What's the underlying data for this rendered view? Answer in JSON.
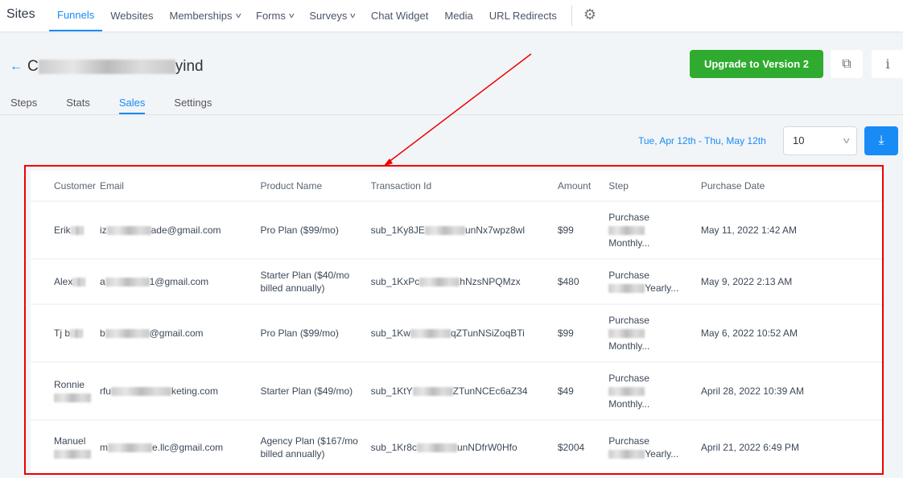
{
  "nav": {
    "brand": "Sites",
    "items": [
      {
        "label": "Funnels",
        "active": true,
        "dropdown": false
      },
      {
        "label": "Websites",
        "dropdown": false
      },
      {
        "label": "Memberships",
        "dropdown": true
      },
      {
        "label": "Forms",
        "dropdown": true
      },
      {
        "label": "Surveys",
        "dropdown": true
      },
      {
        "label": "Chat Widget",
        "dropdown": false
      },
      {
        "label": "Media",
        "dropdown": false
      },
      {
        "label": "URL Redirects",
        "dropdown": false
      }
    ],
    "settings_icon": "gear-icon"
  },
  "page": {
    "title_prefix": "C",
    "title_suffix": "yind",
    "upgrade_label": "Upgrade to Version 2",
    "info_label": "i",
    "tabs": [
      "Steps",
      "Stats",
      "Sales",
      "Settings"
    ],
    "active_tab": "Sales"
  },
  "filters": {
    "date_range": "Tue, Apr 12th - Thu, May 12th",
    "page_size": "10"
  },
  "table": {
    "columns": [
      "Customer",
      "Email",
      "Product Name",
      "Transaction Id",
      "Amount",
      "Step",
      "Purchase Date"
    ],
    "rows": [
      {
        "customer": [
          "Erik",
          ""
        ],
        "email": [
          "iz",
          "ade@gmail.com"
        ],
        "product": "Pro Plan ($99/mo)",
        "txn": [
          "sub_1Ky8JE",
          "unNx7wpz8wl"
        ],
        "amount": "$99",
        "step": [
          "Purchase",
          "",
          "Monthly..."
        ],
        "date": "May 11, 2022 1:42 AM"
      },
      {
        "customer": [
          "Alex",
          ""
        ],
        "email": [
          "a",
          "1@gmail.com"
        ],
        "product": "Starter Plan ($40/mo billed annually)",
        "txn": [
          "sub_1KxPc",
          "hNzsNPQMzx"
        ],
        "amount": "$480",
        "step": [
          "Purchase",
          "",
          "Yearly..."
        ],
        "date": "May 9, 2022 2:13 AM"
      },
      {
        "customer": [
          "Tj b",
          ""
        ],
        "email": [
          "b",
          "@gmail.com"
        ],
        "product": "Pro Plan ($99/mo)",
        "txn": [
          "sub_1Kw",
          "qZTunNSiZoqBTi"
        ],
        "amount": "$99",
        "step": [
          "Purchase",
          "",
          "Monthly..."
        ],
        "date": "May 6, 2022 10:52 AM"
      },
      {
        "customer": [
          "Ronnie",
          ""
        ],
        "email": [
          "rfu",
          "keting.com"
        ],
        "product": "Starter Plan ($49/mo)",
        "txn": [
          "sub_1KtY",
          "ZTunNCEc6aZ34"
        ],
        "amount": "$49",
        "step": [
          "Purchase",
          "",
          "Monthly..."
        ],
        "date": "April 28, 2022 10:39 AM"
      },
      {
        "customer": [
          "Manuel",
          ""
        ],
        "email": [
          "m",
          "e.llc@gmail.com"
        ],
        "product": "Agency Plan ($167/mo billed annually)",
        "txn": [
          "sub_1Kr8c",
          "unNDfrW0Hfo"
        ],
        "amount": "$2004",
        "step": [
          "Purchase",
          "",
          "Yearly..."
        ],
        "date": "April 21, 2022 6:49 PM"
      }
    ]
  },
  "colors": {
    "accent": "#188bf6",
    "upgrade": "#2fab2f",
    "annotation": "#e00000"
  }
}
